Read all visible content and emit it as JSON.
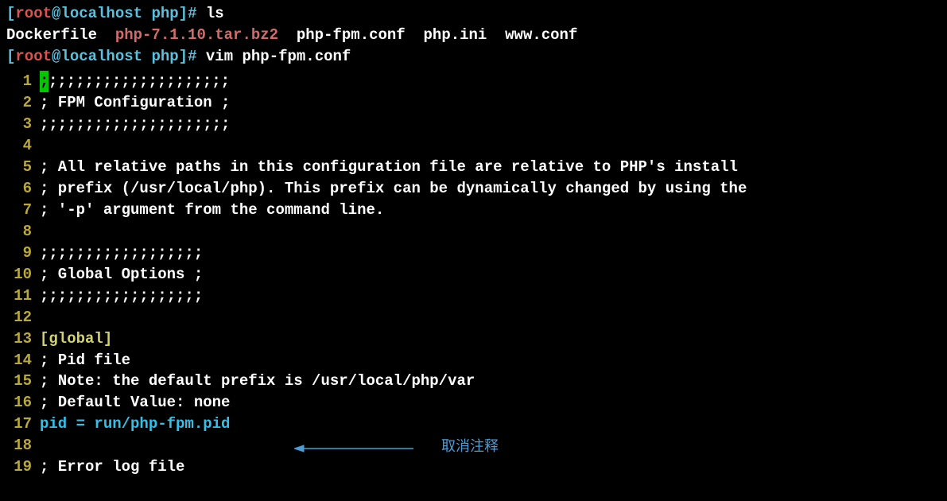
{
  "prompt1": {
    "bracket_open": "[",
    "user": "root",
    "at": "@",
    "host": "localhost",
    "space": " ",
    "path": "php",
    "bracket_close": "]",
    "hash": "#",
    "spacer": " ",
    "command": "ls"
  },
  "ls_output": {
    "file1": "Dockerfile  ",
    "file2": "php-7.1.10.tar.bz2  ",
    "file3": "php-fpm.conf  ",
    "file4": "php.ini  ",
    "file5": "www.conf"
  },
  "prompt2": {
    "bracket_open": "[",
    "user": "root",
    "at": "@",
    "host": "localhost",
    "space": " ",
    "path": "php",
    "bracket_close": "]",
    "hash": "#",
    "spacer": " ",
    "command": "vim php-fpm.conf"
  },
  "lines": {
    "n1": "1",
    "n2": "2",
    "n3": "3",
    "n4": "4",
    "n5": "5",
    "n6": "6",
    "n7": "7",
    "n8": "8",
    "n9": "9",
    "n10": "10",
    "n11": "11",
    "n12": "12",
    "n13": "13",
    "n14": "14",
    "n15": "15",
    "n16": "16",
    "n17": "17",
    "n18": "18",
    "n19": "19"
  },
  "code": {
    "l1_after": ";;;;;;;;;;;;;;;;;;;;",
    "l2": "; FPM Configuration ;",
    "l3": ";;;;;;;;;;;;;;;;;;;;;",
    "l4": "",
    "l5": "; All relative paths in this configuration file are relative to PHP's install",
    "l6": "; prefix (/usr/local/php). This prefix can be dynamically changed by using the",
    "l7": "; '-p' argument from the command line.",
    "l8": "",
    "l9": ";;;;;;;;;;;;;;;;;;",
    "l10": "; Global Options ;",
    "l11": ";;;;;;;;;;;;;;;;;;",
    "l12": "",
    "l13": "[global]",
    "l14": "; Pid file",
    "l15": "; Note: the default prefix is /usr/local/php/var",
    "l16": "; Default Value: none",
    "l17": "pid = run/php-fpm.pid",
    "l18": "",
    "l19": "; Error log file"
  },
  "cursor_char": ";",
  "annotation": "取消注释"
}
